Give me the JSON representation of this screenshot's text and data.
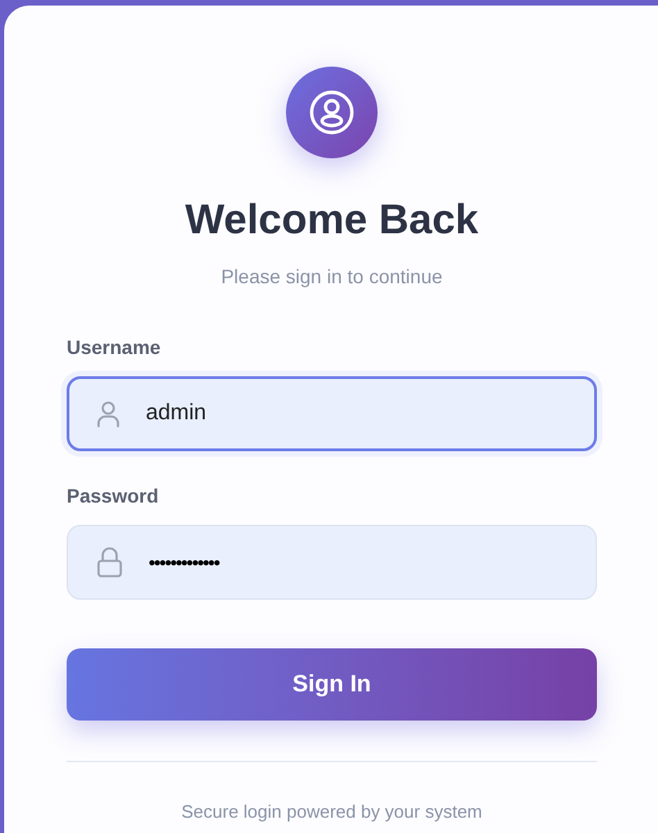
{
  "header": {
    "title": "Welcome Back",
    "subtitle": "Please sign in to continue"
  },
  "fields": [
    {
      "kind": "text",
      "label": "Username",
      "value": "admin",
      "focused": true
    },
    {
      "kind": "password",
      "label": "Password",
      "value": "•••••••••••••",
      "focused": false
    }
  ],
  "button": "Sign In",
  "footer": "Secure login powered by your system"
}
